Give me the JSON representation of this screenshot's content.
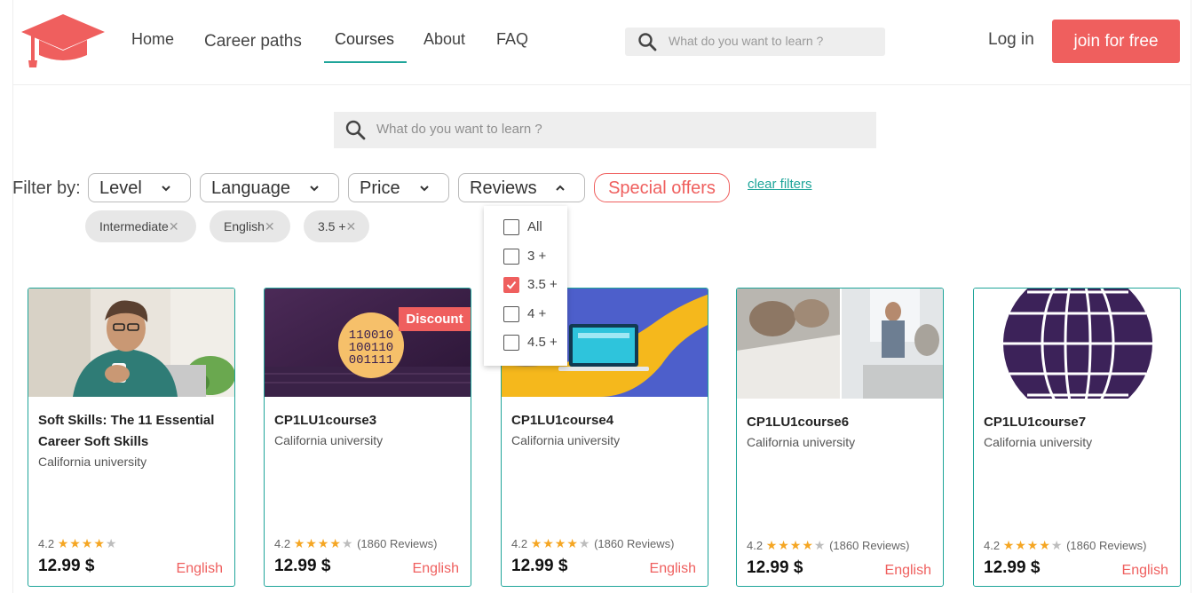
{
  "colors": {
    "accent": "#1fa59a",
    "brand": "#ef5f5e",
    "star": "#f5a623"
  },
  "nav": {
    "items": [
      "Home",
      "Career paths",
      "Courses",
      "About",
      "FAQ"
    ],
    "active": "Courses"
  },
  "header": {
    "search_placeholder": "What do you want to learn ?",
    "login_label": "Log in",
    "join_label": "join for free"
  },
  "main_search": {
    "placeholder": "What do you want to learn ?"
  },
  "filters": {
    "label": "Filter by:",
    "buttons": [
      "Level",
      "Language",
      "Price",
      "Reviews"
    ],
    "open_filter": "Reviews",
    "special_offers": "Special offers",
    "clear": "clear filters",
    "chips": [
      "Intermediate",
      "English",
      "3.5 +"
    ]
  },
  "reviews_dropdown": {
    "options": [
      {
        "label": "All",
        "checked": false
      },
      {
        "label": "3 +",
        "checked": false
      },
      {
        "label": "3.5 +",
        "checked": true
      },
      {
        "label": "4 +",
        "checked": false
      },
      {
        "label": "4.5 +",
        "checked": false
      }
    ]
  },
  "courses": [
    {
      "title": "Soft Skills: The 11 Essential Career Soft Skills",
      "university": "California university",
      "rating": "4.2",
      "stars": 4,
      "reviews": "",
      "price": "12.99 $",
      "language": "English",
      "badge": "",
      "image": "man-with-coffee-photo"
    },
    {
      "title": "CP1LU1course3",
      "university": "California university",
      "rating": "4.2",
      "stars": 4,
      "reviews": "(1860 Reviews)",
      "price": "12.99 $",
      "language": "English",
      "badge": "Discount",
      "image": "binary-code-illustration",
      "binary_lines": [
        "110010",
        "100110",
        "001111"
      ]
    },
    {
      "title": "CP1LU1course4",
      "university": "California university",
      "rating": "4.2",
      "stars": 4,
      "reviews": "(1860 Reviews)",
      "price": "12.99 $",
      "language": "English",
      "badge": "",
      "image": "laptop-illustration"
    },
    {
      "title": "CP1LU1course6",
      "university": "California university",
      "rating": "4.2",
      "stars": 4,
      "reviews": "(1860 Reviews)",
      "price": "12.99 $",
      "language": "English",
      "badge": "",
      "image": "office-meeting-photo"
    },
    {
      "title": "CP1LU1course7",
      "university": "California university",
      "rating": "4.2",
      "stars": 4,
      "reviews": "(1860 Reviews)",
      "price": "12.99 $",
      "language": "English",
      "badge": "",
      "image": "globe-icon"
    }
  ]
}
